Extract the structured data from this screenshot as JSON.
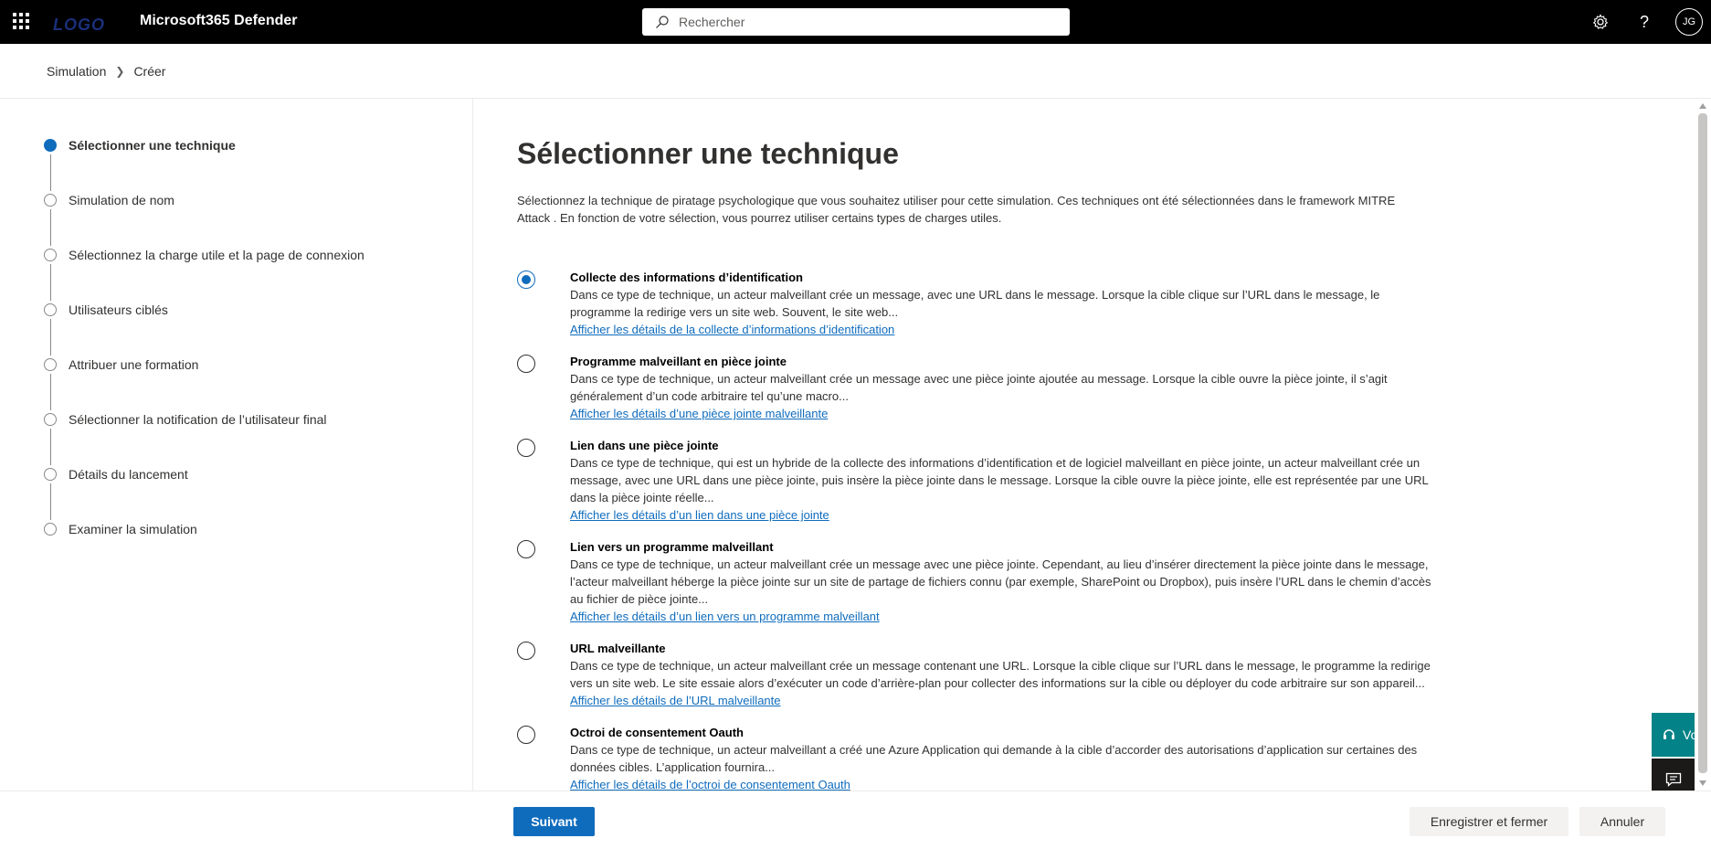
{
  "topbar": {
    "logo": "LOGO",
    "app_name": "Microsoft365 Defender",
    "search_placeholder": "Rechercher",
    "avatar_initials": "JG",
    "icons": [
      "waffle-icon",
      "search-icon",
      "gear-icon",
      "help-icon"
    ]
  },
  "breadcrumb": {
    "items": [
      "Simulation",
      "Créer"
    ]
  },
  "steps": [
    {
      "label": "Sélectionner une technique",
      "active": true
    },
    {
      "label": "Simulation de nom",
      "active": false
    },
    {
      "label": "Sélectionnez la charge utile et la page de connexion",
      "active": false
    },
    {
      "label": "Utilisateurs ciblés",
      "active": false
    },
    {
      "label": "Attribuer une formation",
      "active": false
    },
    {
      "label": "Sélectionner la notification de l’utilisateur final",
      "active": false
    },
    {
      "label": "Détails du lancement",
      "active": false
    },
    {
      "label": "Examiner la simulation",
      "active": false
    }
  ],
  "main": {
    "title": "Sélectionner une technique",
    "intro": "Sélectionnez la technique de piratage psychologique que vous souhaitez utiliser pour cette simulation. Ces techniques ont été sélectionnées dans le framework MITRE Attack . En fonction de votre sélection, vous pourrez utiliser certains types de charges utiles.",
    "options": [
      {
        "title": "Collecte des informations d’identification",
        "desc": "Dans ce type de technique, un acteur malveillant crée un message, avec une URL dans le message. Lorsque la cible clique sur l’URL dans le message, le programme la redirige vers un site web. Souvent, le site web...",
        "link": "Afficher les détails de la collecte d’informations d’identification",
        "checked": true
      },
      {
        "title": "Programme malveillant en pièce jointe",
        "desc": "Dans ce type de technique, un acteur malveillant crée un message avec une pièce jointe ajoutée au message. Lorsque la cible ouvre la pièce jointe, il s’agit généralement d’un code arbitraire tel qu’une macro...",
        "link": "Afficher les détails d’une pièce jointe malveillante",
        "checked": false
      },
      {
        "title": "Lien dans une pièce jointe",
        "desc": "Dans ce type de technique, qui est un hybride de la collecte des informations d’identification et de logiciel malveillant en pièce jointe, un acteur malveillant crée un message, avec une URL dans une pièce jointe, puis insère la pièce jointe dans le message. Lorsque la cible ouvre la pièce jointe, elle est représentée par une URL dans la pièce jointe réelle...",
        "link": "Afficher les détails d’un lien dans une pièce jointe",
        "checked": false
      },
      {
        "title": "Lien vers un programme malveillant",
        "desc": "Dans ce type de technique, un acteur malveillant crée un message avec une pièce jointe. Cependant, au lieu d’insérer directement la pièce jointe dans le message, l’acteur malveillant héberge la pièce jointe sur un site de partage de fichiers connu (par exemple, SharePoint ou Dropbox), puis insère l’URL dans le chemin d’accès au fichier de pièce jointe...",
        "link": "Afficher les détails d’un lien vers un programme malveillant",
        "checked": false
      },
      {
        "title": "URL malveillante",
        "desc": "Dans ce type de technique, un acteur malveillant crée un message contenant une URL. Lorsque la cible clique sur l’URL dans le message, le programme la redirige vers un site web. Le site essaie alors d’exécuter un code d’arrière-plan pour collecter des informations sur la cible ou déployer du code arbitraire sur son appareil...",
        "link": "Afficher les détails de l’URL malveillante",
        "checked": false
      },
      {
        "title": "Octroi de consentement Oauth",
        "desc": "Dans ce type de technique, un acteur malveillant a créé une Azure Application qui demande à la cible d’accorder des autorisations d’application sur certaines des données cibles. L’application fournira...",
        "link": "Afficher les détails de l’octroi de consentement Oauth",
        "checked": false
      }
    ]
  },
  "feedback": {
    "label": "Vo"
  },
  "footer": {
    "next_label": "Suivant",
    "save_close_label": "Enregistrer et fermer",
    "cancel_label": "Annuler"
  },
  "colors": {
    "topbar": "#000000",
    "accent": "#0f6cbd",
    "feedback_teal": "#038387"
  }
}
